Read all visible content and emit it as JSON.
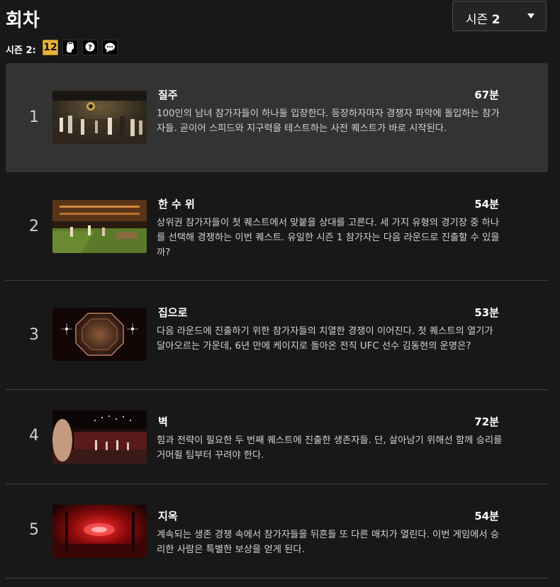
{
  "header": {
    "title": "회차",
    "season_select": {
      "prefix": "시즌",
      "number": "2"
    }
  },
  "rating": {
    "label": "시즌 2:",
    "age_badge": "12",
    "icons": [
      "violence-icon",
      "fear-icon",
      "language-icon"
    ]
  },
  "episodes": [
    {
      "number": "1",
      "title": "질주",
      "duration": "67분",
      "description": "100인의 남녀 참가자들이 하나둘 입장한다. 등장하자마자 경쟁자 파악에 돌입하는 참가자들. 곧이어 스피드와 지구력을 테스트하는 사전 퀘스트가 바로 시작된다."
    },
    {
      "number": "2",
      "title": "한 수 위",
      "duration": "54분",
      "description": "상위권 참가자들이 첫 퀘스트에서 맞붙을 상대를 고른다. 세 가지 유형의 경기장 중 하나를 선택해 경쟁하는 이번 퀘스트. 유일한 시즌 1 참가자는 다음 라운드로 진출할 수 있을까?"
    },
    {
      "number": "3",
      "title": "집으로",
      "duration": "53분",
      "description": "다음 라운드에 진출하기 위한 참가자들의 치열한 경쟁이 이어진다. 첫 퀘스트의 열기가 달아오르는 가운데, 6년 만에 케이지로 돌아온 전직 UFC 선수 김동현의 운명은?"
    },
    {
      "number": "4",
      "title": "벽",
      "duration": "72분",
      "description": "힘과 전략이 필요한 두 번째 퀘스트에 진출한 생존자들. 단, 살아남기 위해선 함께 승리를 거머쥘 팀부터 꾸려야 한다."
    },
    {
      "number": "5",
      "title": "지옥",
      "duration": "54분",
      "description": "계속되는 생존 경쟁 속에서 참가자들을 뒤흔들 또 다른 매치가 열린다. 이번 게임에서 승리한 사람은 특별한 보상을 얻게 된다."
    }
  ],
  "colors": {
    "background": "#181818",
    "active_row": "#333333",
    "rating_badge": "#e8b339",
    "divider": "#404040"
  }
}
